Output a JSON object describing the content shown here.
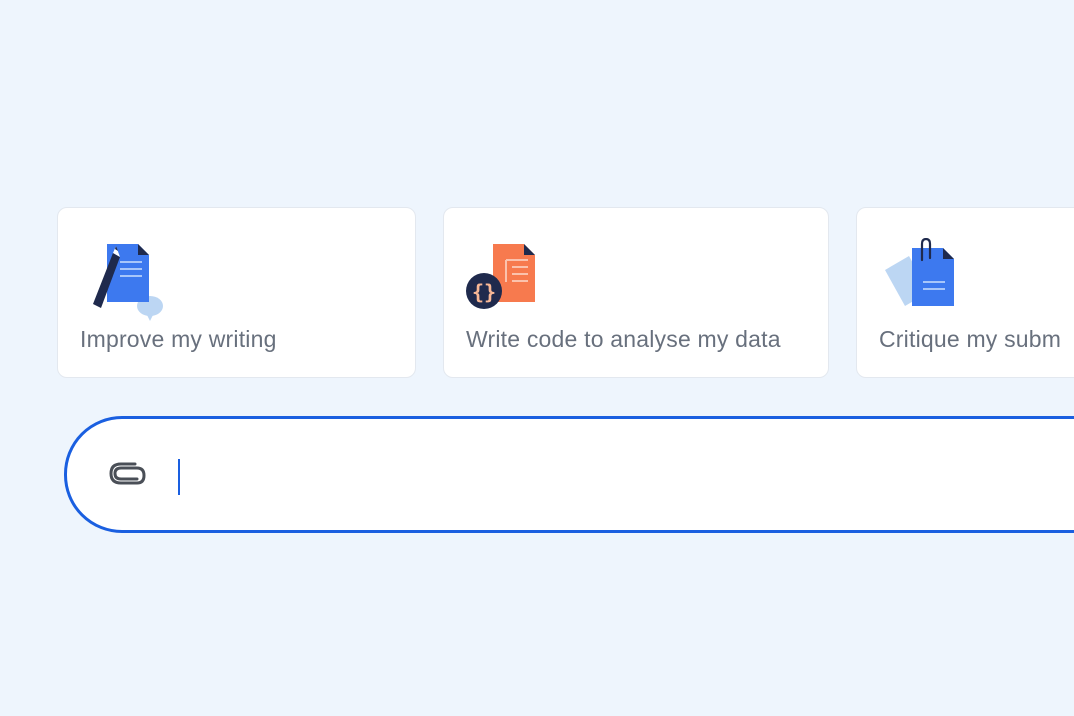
{
  "suggestions": [
    {
      "label": "Improve my writing",
      "icon": "document-pencil-icon"
    },
    {
      "label": "Write code to analyse my data",
      "icon": "code-document-icon"
    },
    {
      "label": "Critique my subm",
      "icon": "clipped-document-icon"
    }
  ],
  "composer": {
    "attach_icon": "paperclip-icon",
    "value": "",
    "placeholder": ""
  },
  "colors": {
    "background": "#eef5fd",
    "accent": "#1a5fe0",
    "card_text": "#68707d",
    "doc_blue": "#3d79ef",
    "doc_orange": "#f77a4e",
    "navy": "#1f2a4d"
  }
}
